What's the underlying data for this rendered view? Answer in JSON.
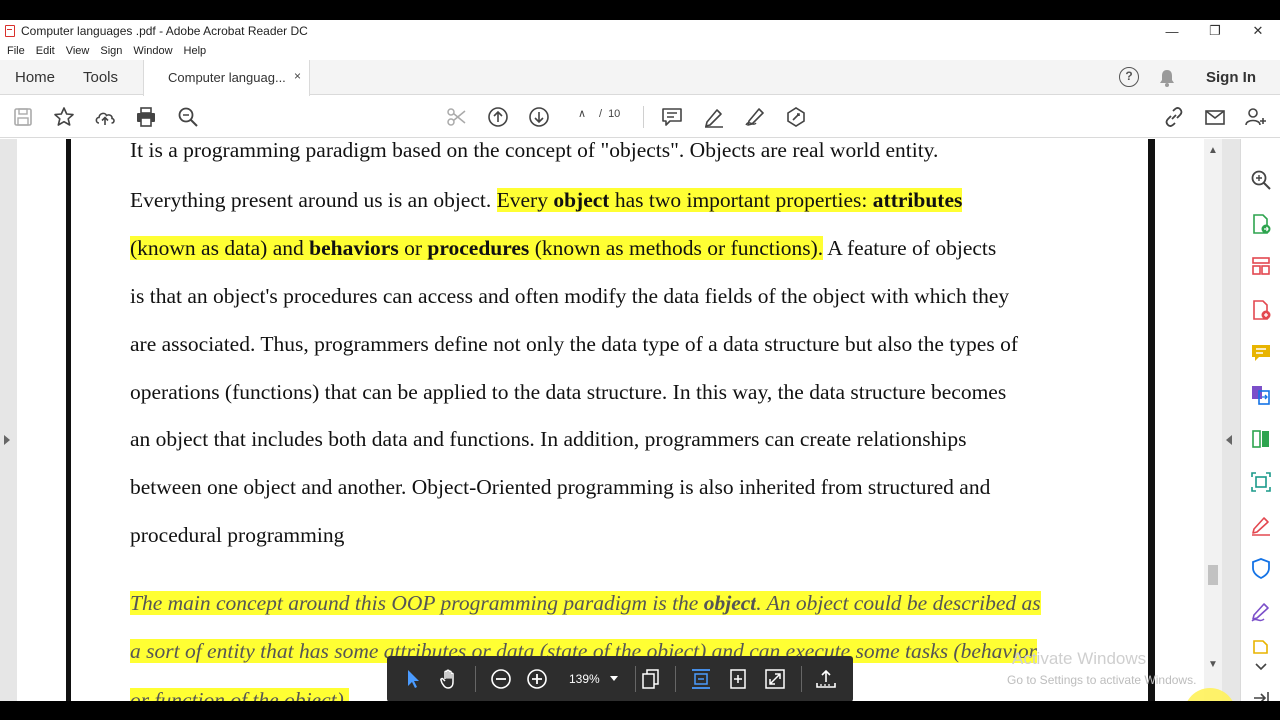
{
  "window": {
    "title": "Computer languages .pdf - Adobe Acrobat Reader DC",
    "minimize": "—",
    "maximize": "❐",
    "close": "✕"
  },
  "menu": [
    "File",
    "Edit",
    "View",
    "Sign",
    "Window",
    "Help"
  ],
  "tabs": {
    "home": "Home",
    "tools": "Tools",
    "document": "Computer languag...",
    "document_close": "×",
    "help": "?",
    "sign_in": "Sign In"
  },
  "toolbar": {
    "page_current": "∧",
    "page_sep": "/",
    "page_total": "10"
  },
  "document": {
    "lines": [
      [
        {
          "t": "It is a programming paradigm based on the concept of \"objects\". Objects are real world entity."
        }
      ],
      [
        {
          "t": "Everything present around us is an object. "
        },
        {
          "t": "Every ",
          "h": true
        },
        {
          "t": "object",
          "h": true,
          "b": true
        },
        {
          "t": " has two important properties: ",
          "h": true
        },
        {
          "t": "attributes",
          "h": true,
          "b": true
        }
      ],
      [
        {
          "t": "(known as data) and ",
          "h": true
        },
        {
          "t": "behaviors",
          "h": true,
          "b": true
        },
        {
          "t": " or ",
          "h": true
        },
        {
          "t": "procedures",
          "h": true,
          "b": true
        },
        {
          "t": " (known as methods or functions).",
          "h": true
        },
        {
          "t": " A feature of objects"
        }
      ],
      [
        {
          "t": "is that an object's procedures can access and often modify the data fields of the object with which they"
        }
      ],
      [
        {
          "t": "are associated. Thus, programmers define not only the data type of a data structure but also the types of"
        }
      ],
      [
        {
          "t": "operations (functions) that can be applied to the data structure. In this way, the data structure becomes"
        }
      ],
      [
        {
          "t": "an object that includes both data and functions. In addition, programmers can create relationships"
        }
      ],
      [
        {
          "t": "between one object and another. Object-Oriented programming is also inherited from structured and"
        }
      ],
      [
        {
          "t": "procedural programming"
        }
      ],
      [
        {
          "t": "The main concept around this OOP programming paradigm is the ",
          "h": true,
          "i": true
        },
        {
          "t": "object",
          "h": true,
          "i": true,
          "b": true
        },
        {
          "t": ". An object could be described as",
          "h": true,
          "i": true
        }
      ],
      [
        {
          "t": "a sort of entity that has some attributes or data (state of the object) and can execute some tasks (behavior",
          "h": true,
          "i": true
        }
      ],
      [
        {
          "t": "or function of the object).",
          "h": true,
          "i": true
        }
      ]
    ]
  },
  "floating_toolbar": {
    "zoom": "139%"
  },
  "watermark": {
    "line1": "Activate Windows",
    "line2": "Go to Settings to activate Windows."
  },
  "colors": {
    "highlight": "#ffff33",
    "accent_blue": "#1473e6",
    "tool_red": "#e34850",
    "tool_green": "#2da44e",
    "tool_yellow": "#e8b400",
    "tool_purple": "#7b4fc9"
  }
}
